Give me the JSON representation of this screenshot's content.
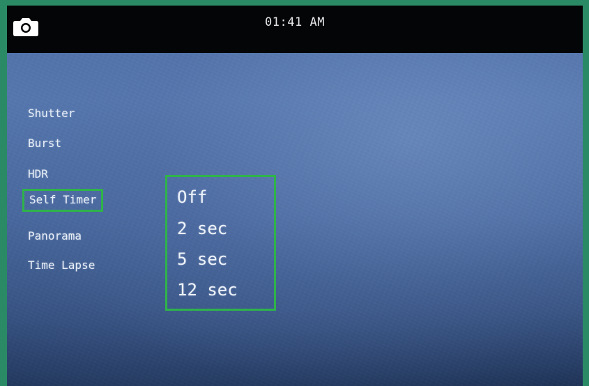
{
  "status_bar": {
    "time": "01:41 AM",
    "mode_icon": "camera-icon"
  },
  "settings_menu": {
    "items": [
      {
        "label": "Shutter"
      },
      {
        "label": "Burst"
      },
      {
        "label": "HDR"
      },
      {
        "label": "Self Timer",
        "selected": true
      },
      {
        "label": "Panorama"
      },
      {
        "label": "Time Lapse"
      }
    ]
  },
  "self_timer_options": {
    "options": [
      {
        "label": "Off"
      },
      {
        "label": "2 sec"
      },
      {
        "label": "5 sec"
      },
      {
        "label": "12 sec"
      }
    ]
  },
  "colors": {
    "highlight": "#2fb34a",
    "top_bar": "#040507",
    "frame": "#2a8a66"
  }
}
